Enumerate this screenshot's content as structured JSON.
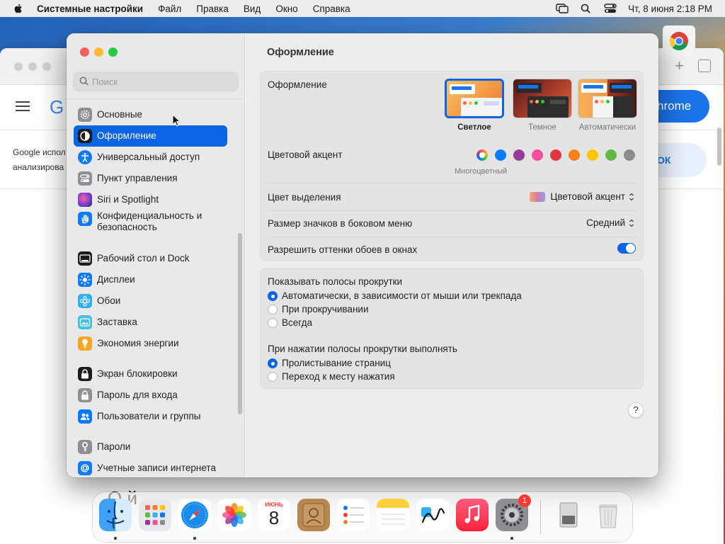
{
  "menubar": {
    "app_name": "Системные настройки",
    "items": [
      "Файл",
      "Правка",
      "Вид",
      "Окно",
      "Справка"
    ],
    "clock": "Чт, 8 июня  2:18 PM"
  },
  "background_browser": {
    "logo_letter": "G",
    "chrome_button": "hrome",
    "ok_button": "ОК",
    "text_line1": "Google испол",
    "text_line2": "анализирова",
    "heading": "О        й"
  },
  "sidebar": {
    "search_placeholder": "Поиск",
    "items": [
      {
        "label": "Основные",
        "icon": "gear-icon",
        "color": "#8e8e93"
      },
      {
        "label": "Оформление",
        "icon": "appearance-icon",
        "color": "#1c1c1e",
        "selected": true
      },
      {
        "label": "Универсальный доступ",
        "icon": "accessibility-icon",
        "color": "#0a7aff"
      },
      {
        "label": "Пункт управления",
        "icon": "control-center-icon",
        "color": "#8e8e93"
      },
      {
        "label": "Siri и Spotlight",
        "icon": "siri-icon",
        "color": "#6e3cd6"
      },
      {
        "label": "Конфиденциальность и безопасность",
        "icon": "hand-icon",
        "color": "#0a7aff"
      },
      {
        "label": "Рабочий стол и Dock",
        "icon": "dock-icon",
        "color": "#1c1c1e"
      },
      {
        "label": "Дисплеи",
        "icon": "display-icon",
        "color": "#0a7aff"
      },
      {
        "label": "Обои",
        "icon": "wallpaper-icon",
        "color": "#30b0f5"
      },
      {
        "label": "Заставка",
        "icon": "screensaver-icon",
        "color": "#44c0e0"
      },
      {
        "label": "Экономия энергии",
        "icon": "energy-icon",
        "color": "#f5a623"
      },
      {
        "label": "Экран блокировки",
        "icon": "lock-screen-icon",
        "color": "#1c1c1e"
      },
      {
        "label": "Пароль для входа",
        "icon": "lock-icon",
        "color": "#8e8e93"
      },
      {
        "label": "Пользователи и группы",
        "icon": "users-icon",
        "color": "#0a7aff"
      },
      {
        "label": "Пароли",
        "icon": "key-icon",
        "color": "#8e8e93"
      },
      {
        "label": "Учетные записи интернета",
        "icon": "at-icon",
        "color": "#0a7aff"
      }
    ]
  },
  "content": {
    "title": "Оформление",
    "appearance": {
      "label": "Оформление",
      "options": [
        {
          "label": "Светлое",
          "selected": true
        },
        {
          "label": "Темное",
          "selected": false
        },
        {
          "label": "Автоматически",
          "selected": false
        }
      ]
    },
    "accent": {
      "label": "Цветовой акцент",
      "selected_label": "Многоцветный",
      "colors": [
        "multicolor",
        "#0a7aff",
        "#953d96",
        "#f74f9e",
        "#e0383e",
        "#f7821b",
        "#ffc600",
        "#62ba46",
        "#8c8c8c"
      ]
    },
    "highlight": {
      "label": "Цвет выделения",
      "value": "Цветовой акцент"
    },
    "sidebar_icon_size": {
      "label": "Размер значков в боковом меню",
      "value": "Средний"
    },
    "wallpaper_tinting": {
      "label": "Разрешить оттенки обоев в окнах",
      "on": true
    },
    "show_scrollbars": {
      "label": "Показывать полосы прокрутки",
      "options": [
        {
          "label": "Автоматически, в зависимости от мыши или трекпада",
          "checked": true
        },
        {
          "label": "При прокручивании",
          "checked": false
        },
        {
          "label": "Всегда",
          "checked": false
        }
      ]
    },
    "click_scrollbar": {
      "label": "При нажатии полосы прокрутки выполнять",
      "options": [
        {
          "label": "Пролистывание страниц",
          "checked": true
        },
        {
          "label": "Переход к месту нажатия",
          "checked": false
        }
      ]
    },
    "help": "?"
  },
  "dock": {
    "apps": [
      {
        "name": "Finder",
        "icon": "finder-icon",
        "running": true
      },
      {
        "name": "Launchpad",
        "icon": "launchpad-icon",
        "running": false
      },
      {
        "name": "Safari",
        "icon": "safari-icon",
        "running": true
      },
      {
        "name": "Photos",
        "icon": "photos-icon",
        "running": false
      },
      {
        "name": "Calendar",
        "icon": "calendar-icon",
        "running": false,
        "month": "ИЮНЬ",
        "day": "8"
      },
      {
        "name": "Contacts",
        "icon": "contacts-icon",
        "running": false
      },
      {
        "name": "Reminders",
        "icon": "reminders-icon",
        "running": false
      },
      {
        "name": "Notes",
        "icon": "notes-icon",
        "running": false
      },
      {
        "name": "Freeform",
        "icon": "freeform-icon",
        "running": false
      },
      {
        "name": "Music",
        "icon": "music-icon",
        "running": false
      },
      {
        "name": "System Settings",
        "icon": "system-settings-icon",
        "running": true,
        "badge": "1"
      },
      {
        "name": "Disk",
        "icon": "disk-icon",
        "running": false
      },
      {
        "name": "Trash",
        "icon": "trash-icon",
        "running": false
      }
    ]
  }
}
